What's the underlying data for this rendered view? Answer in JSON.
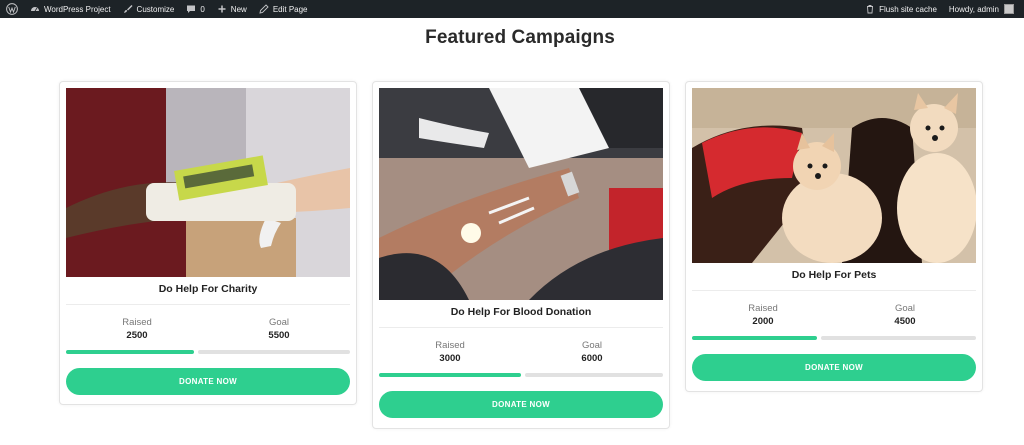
{
  "adminbar": {
    "site_name": "WordPress Project",
    "customize": "Customize",
    "comments_count": "0",
    "new": "New",
    "edit_page": "Edit Page",
    "flush_cache": "Flush site cache",
    "howdy": "Howdy, admin"
  },
  "section": {
    "title": "Featured Campaigns"
  },
  "campaigns": [
    {
      "title": "Do Help For Charity",
      "raised_label": "Raised",
      "raised": "2500",
      "goal_label": "Goal",
      "goal": "5500",
      "progress": 0.45,
      "button": "DONATE NOW",
      "image": "hands-exchanging-package-photo"
    },
    {
      "title": "Do Help For Blood Donation",
      "raised_label": "Raised",
      "raised": "3000",
      "goal_label": "Goal",
      "goal": "6000",
      "progress": 0.5,
      "button": "DONATE NOW",
      "image": "blood-donation-photo"
    },
    {
      "title": "Do Help For Pets",
      "raised_label": "Raised",
      "raised": "2000",
      "goal_label": "Goal",
      "goal": "4500",
      "progress": 0.44,
      "button": "DONATE NOW",
      "image": "pomeranian-dogs-photo"
    }
  ],
  "colors": {
    "accent": "#2ecf8f",
    "adminbar": "#1d2327",
    "track": "#e1e1e1"
  }
}
